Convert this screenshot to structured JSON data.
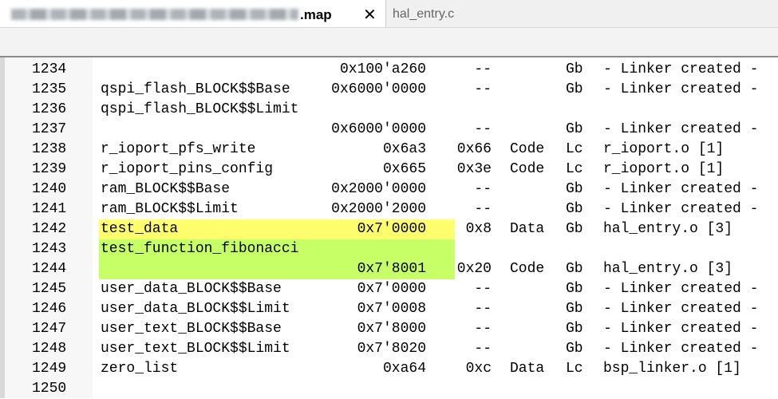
{
  "tabs": {
    "active_name": ".map",
    "second_name": "hal_entry.c",
    "close_glyph": "✕"
  },
  "colors": {
    "highlight_yellow": "#ffff6e",
    "highlight_green": "#c7ff66"
  },
  "lines": [
    {
      "num": "1234",
      "sym": "",
      "addr": "0x100'a260",
      "size": "--",
      "type": "",
      "scope": "Gb",
      "obj": "- Linker created -"
    },
    {
      "num": "1235",
      "sym": "qspi_flash_BLOCK$$Base",
      "addr": "0x6000'0000",
      "size": "--",
      "type": "",
      "scope": "Gb",
      "obj": "- Linker created -"
    },
    {
      "num": "1236",
      "sym": "qspi_flash_BLOCK$$Limit",
      "addr": "",
      "size": "",
      "type": "",
      "scope": "",
      "obj": ""
    },
    {
      "num": "1237",
      "sym": "",
      "addr": "0x6000'0000",
      "size": "--",
      "type": "",
      "scope": "Gb",
      "obj": "- Linker created -"
    },
    {
      "num": "1238",
      "sym": "r_ioport_pfs_write",
      "addr": "0x6a3",
      "size": "0x66",
      "type": "Code",
      "scope": "Lc",
      "obj": "r_ioport.o [1]"
    },
    {
      "num": "1239",
      "sym": "r_ioport_pins_config",
      "addr": "0x665",
      "size": "0x3e",
      "type": "Code",
      "scope": "Lc",
      "obj": "r_ioport.o [1]"
    },
    {
      "num": "1240",
      "sym": "ram_BLOCK$$Base",
      "addr": "0x2000'0000",
      "size": "--",
      "type": "",
      "scope": "Gb",
      "obj": "- Linker created -"
    },
    {
      "num": "1241",
      "sym": "ram_BLOCK$$Limit",
      "addr": "0x2000'2000",
      "size": "--",
      "type": "",
      "scope": "Gb",
      "obj": "- Linker created -"
    },
    {
      "num": "1242",
      "sym": "test_data",
      "addr": "0x7'0000",
      "size": "0x8",
      "type": "Data",
      "scope": "Gb",
      "obj": "hal_entry.o [3]"
    },
    {
      "num": "1243",
      "sym": "test_function_fibonacci",
      "addr": "",
      "size": "",
      "type": "",
      "scope": "",
      "obj": ""
    },
    {
      "num": "1244",
      "sym": "",
      "addr": "0x7'8001",
      "size": "0x20",
      "type": "Code",
      "scope": "Gb",
      "obj": "hal_entry.o [3]"
    },
    {
      "num": "1245",
      "sym": "user_data_BLOCK$$Base",
      "addr": "0x7'0000",
      "size": "--",
      "type": "",
      "scope": "Gb",
      "obj": "- Linker created -"
    },
    {
      "num": "1246",
      "sym": "user_data_BLOCK$$Limit",
      "addr": "0x7'0008",
      "size": "--",
      "type": "",
      "scope": "Gb",
      "obj": "- Linker created -"
    },
    {
      "num": "1247",
      "sym": "user_text_BLOCK$$Base",
      "addr": "0x7'8000",
      "size": "--",
      "type": "",
      "scope": "Gb",
      "obj": "- Linker created -"
    },
    {
      "num": "1248",
      "sym": "user_text_BLOCK$$Limit",
      "addr": "0x7'8020",
      "size": "--",
      "type": "",
      "scope": "Gb",
      "obj": "- Linker created -"
    },
    {
      "num": "1249",
      "sym": "zero_list",
      "addr": "0xa64",
      "size": "0xc",
      "type": "Data",
      "scope": "Lc",
      "obj": "bsp_linker.o [1]"
    },
    {
      "num": "1250",
      "sym": "",
      "addr": "",
      "size": "",
      "type": "",
      "scope": "",
      "obj": ""
    }
  ]
}
